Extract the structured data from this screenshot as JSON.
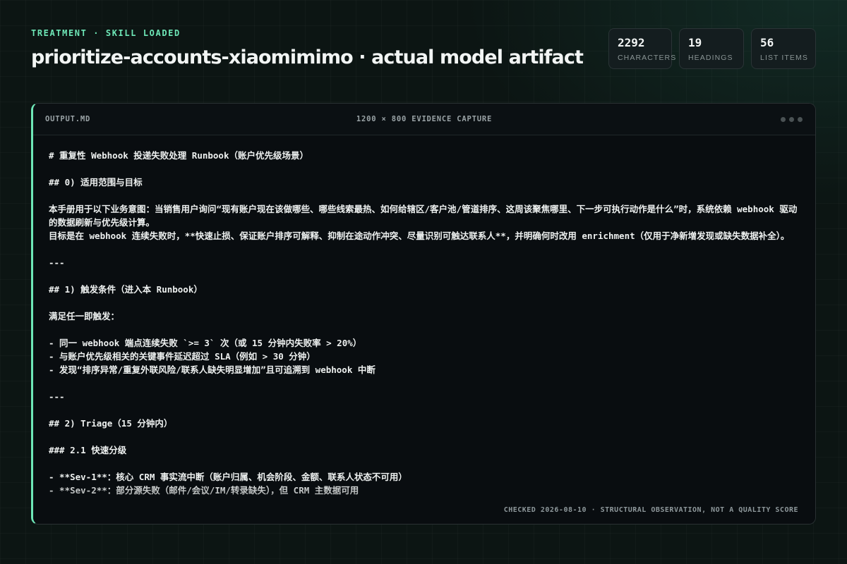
{
  "header": {
    "eyebrow": "TREATMENT · SKILL LOADED",
    "title": "prioritize-accounts-xiaomimimo · actual model artifact"
  },
  "stats": [
    {
      "value": "2292",
      "label": "CHARACTERS"
    },
    {
      "value": "19",
      "label": "HEADINGS"
    },
    {
      "value": "56",
      "label": "LIST ITEMS"
    }
  ],
  "panel": {
    "filename": "OUTPUT.MD",
    "caption": "1200 × 800 EVIDENCE CAPTURE",
    "footer": "CHECKED 2026-08-10 · STRUCTURAL OBSERVATION, NOT A QUALITY SCORE",
    "lines": [
      "# 重复性 Webhook 投递失败处理 Runbook（账户优先级场景）",
      "",
      "## 0) 适用范围与目标",
      "",
      "本手册用于以下业务意图：当销售用户询问“现有账户现在该做哪些、哪些线索最热、如何给辖区/客户池/管道排序、这周该聚焦哪里、下一步可执行动作是什么”时，系统依赖 webhook 驱动的数据刷新与优先级计算。",
      "目标是在 webhook 连续失败时，**快速止损、保证账户排序可解释、抑制在途动作冲突、尽量识别可触达联系人**，并明确何时改用 enrichment（仅用于净新增发现或缺失数据补全）。",
      "",
      "---",
      "",
      "## 1) 触发条件（进入本 Runbook）",
      "",
      "满足任一即触发：",
      "",
      "- 同一 webhook 端点连续失败 `>= 3` 次（或 15 分钟内失败率 > 20%）",
      "- 与账户优先级相关的关键事件延迟超过 SLA（例如 > 30 分钟）",
      "- 发现“排序异常/重复外联风险/联系人缺失明显增加”且可追溯到 webhook 中断",
      "",
      "---",
      "",
      "## 2) Triage（15 分钟内）",
      "",
      "### 2.1 快速分级",
      "",
      "- **Sev-1**：核心 CRM 事实流中断（账户归属、机会阶段、金额、联系人状态不可用）",
      "- **Sev-2**：部分源失败（邮件/会议/IM/转录缺失），但 CRM 主数据可用"
    ]
  }
}
